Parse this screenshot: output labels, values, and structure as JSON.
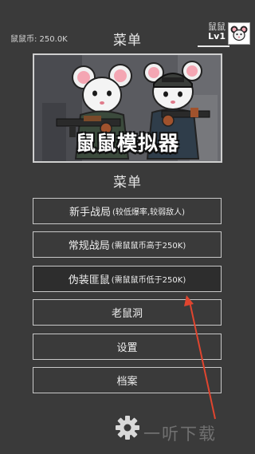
{
  "header": {
    "coins_text": "鼠鼠币: 250.0K",
    "title": "菜单",
    "player_name": "鼠鼠",
    "player_level": "Lv1"
  },
  "banner": {
    "title": "鼠鼠模拟器"
  },
  "menu": {
    "title": "菜单",
    "buttons": [
      {
        "main": "新手战局",
        "sub": "(较低爆率,较弱敌人)"
      },
      {
        "main": "常规战局",
        "sub": "(需鼠鼠币高于250K)"
      },
      {
        "main": "伪装匪鼠",
        "sub": "(需鼠鼠币低于250K)"
      },
      {
        "main": "老鼠洞",
        "sub": ""
      },
      {
        "main": "设置",
        "sub": ""
      },
      {
        "main": "档案",
        "sub": ""
      }
    ]
  },
  "watermark": "一听下载",
  "colors": {
    "background": "#3a3a3a",
    "button_border": "#c8c8c8",
    "annotation_arrow": "#e0452f"
  }
}
